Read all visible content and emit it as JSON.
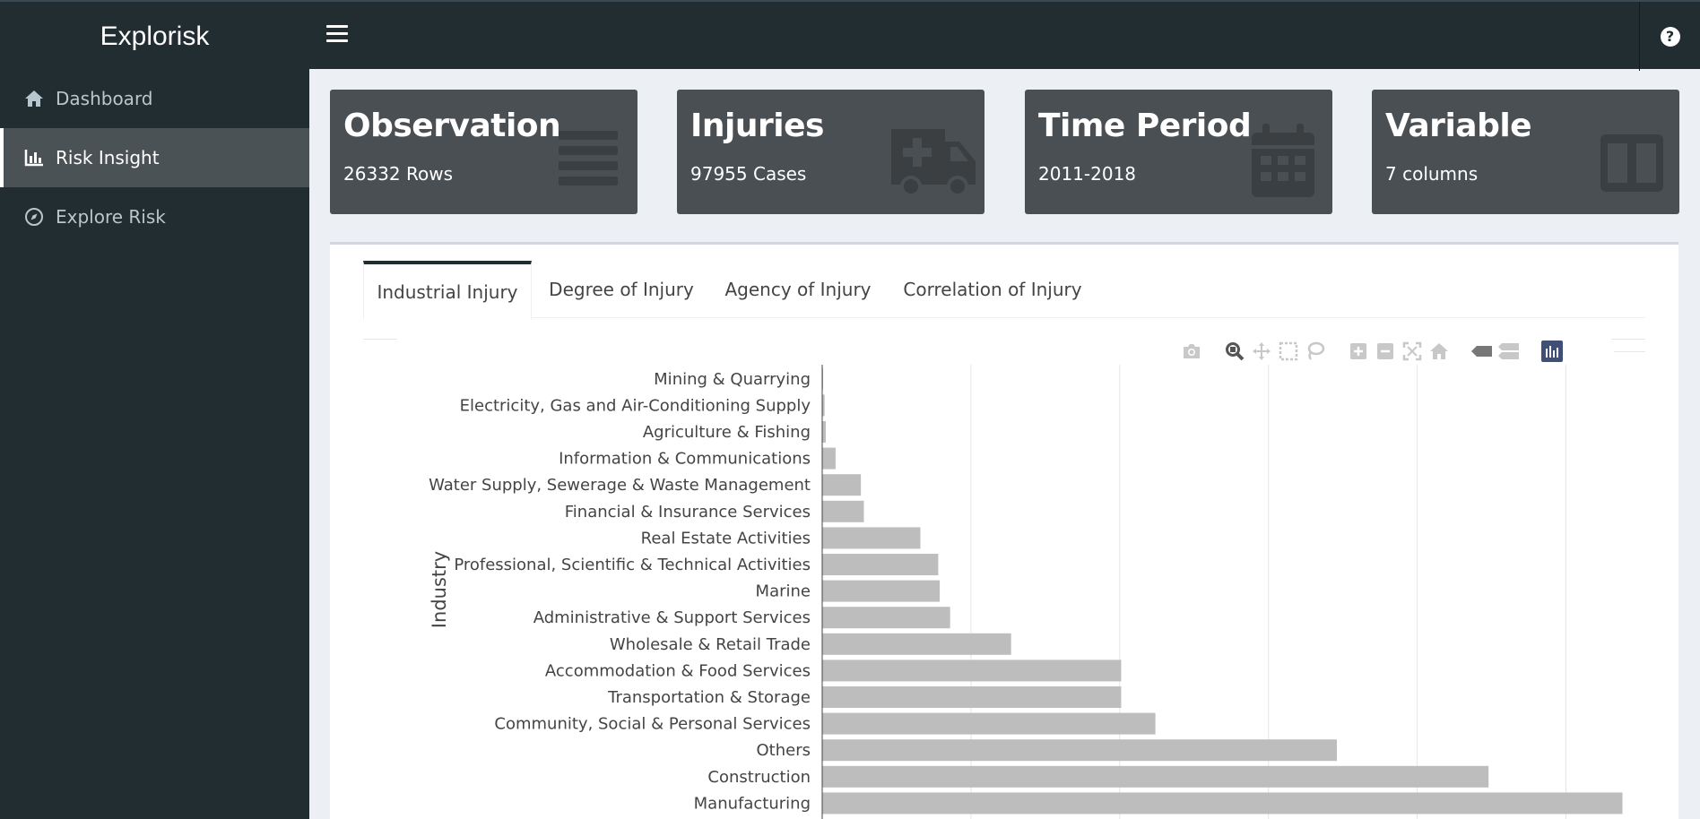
{
  "app": {
    "title": "Explorisk"
  },
  "sidebar": {
    "items": [
      {
        "label": "Dashboard",
        "icon": "home-icon"
      },
      {
        "label": "Risk Insight",
        "icon": "bar-chart-icon"
      },
      {
        "label": "Explore Risk",
        "icon": "compass-icon"
      }
    ]
  },
  "value_boxes": [
    {
      "title": "Observation",
      "subtitle": "26332 Rows",
      "icon": "list-icon"
    },
    {
      "title": "Injuries",
      "subtitle": "97955 Cases",
      "icon": "ambulance-icon"
    },
    {
      "title": "Time Period",
      "subtitle": "2011-2018",
      "icon": "calendar-icon"
    },
    {
      "title": "Variable",
      "subtitle": "7 columns",
      "icon": "columns-icon"
    }
  ],
  "tabs": [
    {
      "label": "Industrial Injury",
      "active": true
    },
    {
      "label": "Degree of Injury",
      "active": false
    },
    {
      "label": "Agency of Injury",
      "active": false
    },
    {
      "label": "Correlation of Injury",
      "active": false
    }
  ],
  "modebar": [
    "camera-icon",
    "zoom-icon",
    "pan-icon",
    "box-select-icon",
    "lasso-icon",
    "zoom-in-icon",
    "zoom-out-icon",
    "autoscale-icon",
    "reset-axes-icon",
    "hover-closest-icon",
    "hover-compare-icon",
    "plotly-logo-icon"
  ],
  "colors": {
    "bar": "#bdbdbd",
    "sidebar": "#222d32",
    "box": "#4a4f53"
  },
  "chart_data": {
    "type": "bar",
    "orientation": "horizontal",
    "ylabel": "Industry",
    "xlabel": "",
    "categories": [
      "Mining & Quarrying",
      "Electricity, Gas and Air-Conditioning Supply",
      "Agriculture & Fishing",
      "Information & Communications",
      "Water Supply, Sewerage & Waste Management",
      "Financial & Insurance Services",
      "Real Estate Activities",
      "Professional, Scientific & Technical Activities",
      "Marine",
      "Administrative & Support Services",
      "Wholesale & Retail Trade",
      "Accommodation & Food Services",
      "Transportation & Storage",
      "Community, Social & Personal Services",
      "Others",
      "Construction",
      "Manufacturing"
    ],
    "values": [
      20,
      80,
      120,
      450,
      1300,
      1400,
      3300,
      3900,
      3950,
      4300,
      6350,
      10050,
      10050,
      11200,
      17300,
      22400,
      26900
    ],
    "xlim": [
      0,
      28000
    ],
    "gridlines": [
      5000,
      10000,
      15000,
      20000,
      25000
    ],
    "grid": true
  }
}
